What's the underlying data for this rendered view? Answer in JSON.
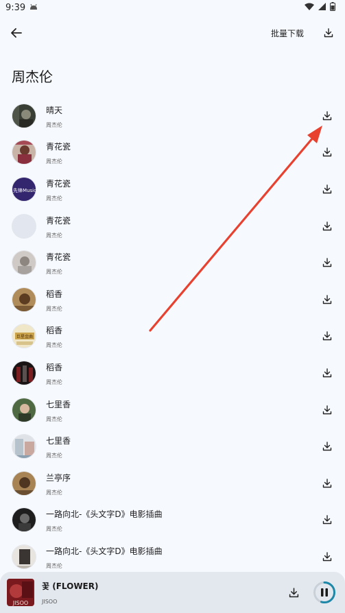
{
  "status_bar": {
    "time": "9:39"
  },
  "header": {
    "batch_download_label": "批量下载"
  },
  "page_title": "周杰伦",
  "songs": [
    {
      "title": "晴天",
      "artist": "周杰伦"
    },
    {
      "title": "青花瓷",
      "artist": "周杰伦"
    },
    {
      "title": "青花瓷",
      "artist": "周杰伦"
    },
    {
      "title": "青花瓷",
      "artist": "周杰伦"
    },
    {
      "title": "青花瓷",
      "artist": "周杰伦"
    },
    {
      "title": "稻香",
      "artist": "周杰伦"
    },
    {
      "title": "稻香",
      "artist": "周杰伦"
    },
    {
      "title": "稻香",
      "artist": "周杰伦"
    },
    {
      "title": "七里香",
      "artist": "周杰伦"
    },
    {
      "title": "七里香",
      "artist": "周杰伦"
    },
    {
      "title": "兰亭序",
      "artist": "周杰伦"
    },
    {
      "title": "一路向北-《头文字D》电影插曲",
      "artist": "周杰伦"
    },
    {
      "title": "一路向北-《头文字D》电影插曲",
      "artist": "周杰伦"
    }
  ],
  "cover_labels": {
    "cover_2": "先锋Music",
    "cover_6": "巨星金曲"
  },
  "mini_player": {
    "title": "꽃 (FLOWER)",
    "artist": "JISOO",
    "cover_text": "JISOO",
    "progress": 0.55
  },
  "colors": {
    "accent": "#1e88a8",
    "annotation_arrow": "#e8412f",
    "background": "#f6f9fd"
  }
}
